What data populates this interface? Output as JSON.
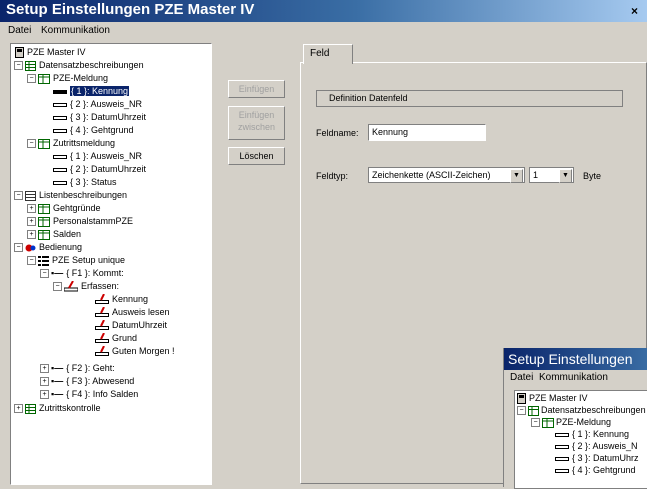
{
  "window": {
    "title": "Setup Einstellungen PZE Master IV",
    "close_label": "×"
  },
  "menu": [
    "Datei",
    "Kommunikation"
  ],
  "tree": {
    "root": "PZE Master IV",
    "datensatz": "Datensatzbeschreibungen",
    "pze_meldung": "PZE-Meldung",
    "kennung": "{ 1 }: Kennung",
    "ausweis": "{ 2 }: Ausweis_NR",
    "datum": "{ 3 }: DatumUhrzeit",
    "gehtgrund": "{ 4 }: Gehtgrund",
    "zutrittsmeldung": "Zutrittsmeldung",
    "z_ausweis": "{ 1 }: Ausweis_NR",
    "z_datum": "{ 2 }: DatumUhrzeit",
    "z_status": "{ 3 }: Status",
    "listen": "Listenbeschreibungen",
    "gehtgruende": "Gehtgründe",
    "personalstamm": "PersonalstammPZE",
    "salden": "Salden",
    "bedienung": "Bedienung",
    "setup_unique": "PZE Setup unique",
    "f1": "{ F1 }: Kommt:",
    "erfassen": "Erfassen:",
    "e_kennung": "Kennung",
    "e_ausweis": "Ausweis lesen",
    "e_datum": "DatumUhrzeit",
    "e_grund": "Grund",
    "e_guten": "Guten Morgen !",
    "f2": "{ F2 }: Geht:",
    "f3": "{ F3 }: Abwesend",
    "f4": "{ F4 }: Info Salden",
    "zutritt": "Zutrittskontrolle"
  },
  "buttons": {
    "einfuegen": "Einfügen",
    "einfuegen_zw1": "Einfügen",
    "einfuegen_zw2": "zwischen",
    "loeschen": "Löschen"
  },
  "panel": {
    "tab": "Feld",
    "group": "Definition Datenfeld",
    "feldname_label": "Feldname:",
    "feldname_value": "Kennung",
    "feldtyp_label": "Feldtyp:",
    "feldtyp_value": "Zeichenkette (ASCII-Zeichen)",
    "size_value": "1",
    "unit": "Byte"
  },
  "win2": {
    "title": "Setup Einstellungen",
    "menu": [
      "Datei",
      "Kommunikation"
    ],
    "root": "PZE Master IV",
    "datensatz": "Datensatzbeschreibungen",
    "pze_meldung": "PZE-Meldung",
    "kennung": "{ 1 }: Kennung",
    "ausweis": "{ 2 }: Ausweis_N",
    "datum": "{ 3 }: DatumUhrz",
    "gehtgrund": "{ 4 }: Gehtgrund"
  }
}
